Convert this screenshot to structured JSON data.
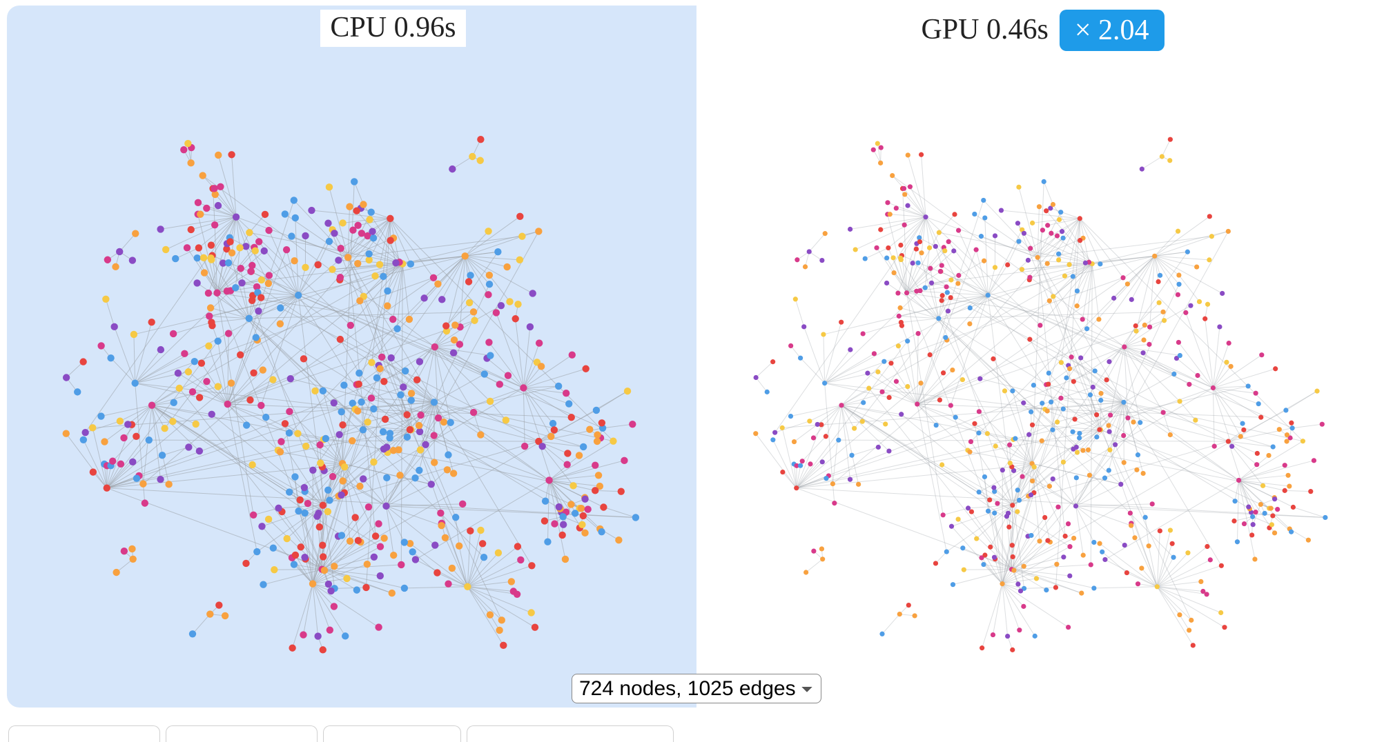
{
  "cpu": {
    "label": "CPU",
    "time": "0.96s"
  },
  "gpu": {
    "label": "GPU",
    "time": "0.46s"
  },
  "speedup_label": "× 2.04",
  "dataset_selected": "724 nodes, 1025 edges",
  "colors": {
    "cpu_bg": "#d6e6fa",
    "gpu_bg": "#ffffff",
    "badge_bg": "#1e9be9",
    "edge": "#9aa0a6",
    "node_palette": [
      "#e8443f",
      "#f8a13f",
      "#f6c945",
      "#4f9de6",
      "#8a4bc4",
      "#d83a8a"
    ]
  },
  "graph_stats": {
    "nodes": 724,
    "edges": 1025
  },
  "graph_seed": 42,
  "render": {
    "hub_count": 24,
    "hub_children_min": 8,
    "hub_children_max": 26,
    "extra_edges": 120
  }
}
